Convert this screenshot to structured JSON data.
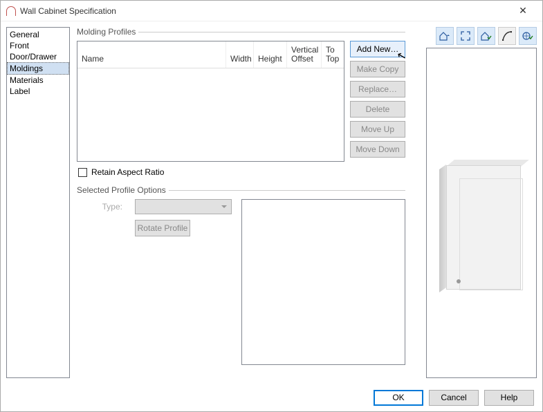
{
  "window": {
    "title": "Wall Cabinet Specification"
  },
  "sidebar": {
    "items": [
      {
        "label": "General"
      },
      {
        "label": "Front"
      },
      {
        "label": "Door/Drawer"
      },
      {
        "label": "Moldings"
      },
      {
        "label": "Materials"
      },
      {
        "label": "Label"
      }
    ],
    "selected_index": 3
  },
  "sections": {
    "profiles_legend": "Molding Profiles",
    "options_legend": "Selected Profile Options"
  },
  "table": {
    "columns": {
      "name": "Name",
      "width": "Width",
      "height": "Height",
      "voffset": "Vertical Offset",
      "totop": "To Top"
    }
  },
  "buttons": {
    "add_new": "Add New…",
    "make_copy": "Make Copy",
    "replace": "Replace…",
    "delete": "Delete",
    "move_up": "Move Up",
    "move_down": "Move Down"
  },
  "checkbox": {
    "retain": "Retain Aspect Ratio"
  },
  "options": {
    "type_label": "Type:",
    "rotate": "Rotate Profile"
  },
  "toolbar_icons": {
    "house_dd": "house-dropdown-icon",
    "expand": "expand-icon",
    "house_check": "house-check-icon",
    "curve": "curve-icon",
    "globe": "globe-check-icon"
  },
  "footer": {
    "ok": "OK",
    "cancel": "Cancel",
    "help": "Help"
  }
}
